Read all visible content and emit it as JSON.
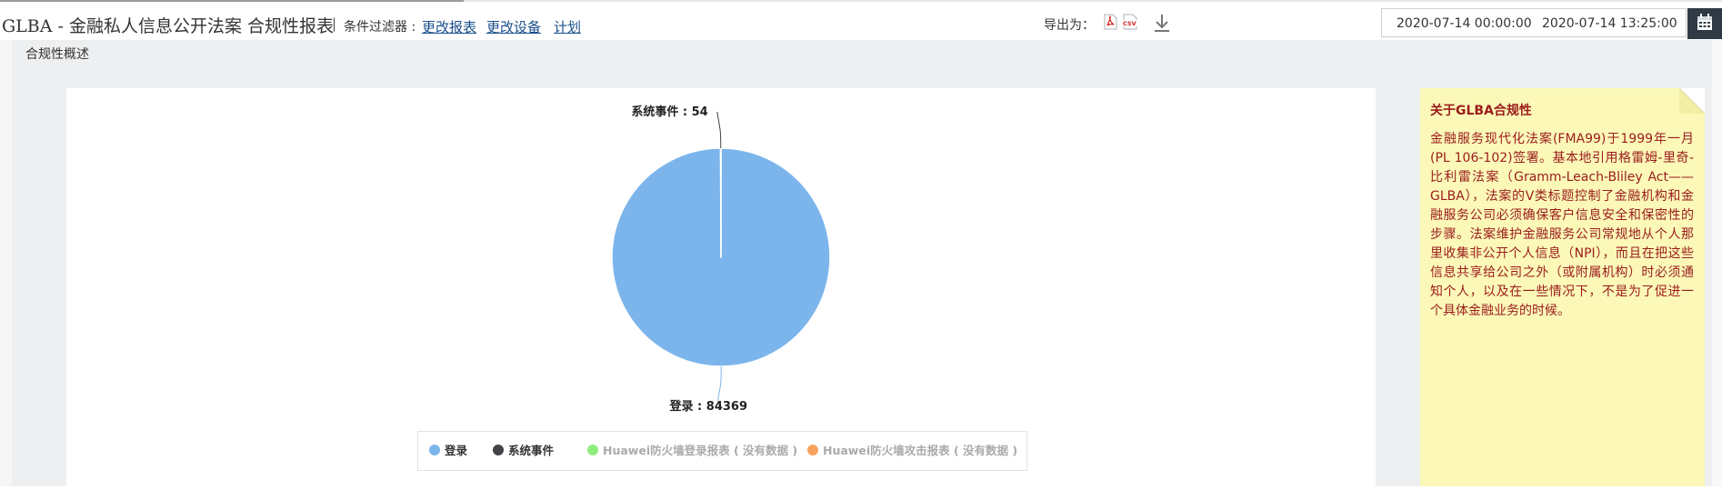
{
  "header": {
    "title": "GLBA - 金融私人信息公开法案 合规性报表",
    "separator": "|",
    "filter_label": "条件过滤器 : ",
    "links": [
      "更改报表",
      "更改设备",
      "计划"
    ],
    "export_label": "导出为：",
    "date_start": "2020-07-14 00:00:00",
    "date_end": "2020-07-14 13:25:00"
  },
  "section_title": "合规性概述",
  "chart_data": {
    "type": "pie",
    "slices": [
      {
        "name": "登录",
        "value": 84369,
        "color": "#7cb5ec",
        "label": "登录 : 84369"
      },
      {
        "name": "系统事件",
        "value": 54,
        "color": "#434348",
        "label": "系统事件 : 54"
      }
    ],
    "legend": [
      {
        "label": "登录",
        "color": "#7cb5ec",
        "has_data": true
      },
      {
        "label": "系统事件",
        "color": "#434348",
        "has_data": true
      },
      {
        "label": "Huawei防火墙登录报表 ( 没有数据 )",
        "color": "#90ed7d",
        "has_data": false
      },
      {
        "label": "Huawei防火墙攻击报表 ( 没有数据 )",
        "color": "#f7a35c",
        "has_data": false
      }
    ]
  },
  "note": {
    "title": "关于GLBA合规性",
    "body": "金融服务现代化法案(FMA99)于1999年一月(PL 106-102)签署。基本地引用格雷姆-里奇-比利雷法案（Gramm-Leach-Bliley Act——GLBA），法案的V类标题控制了金融机构和金融服务公司必须确保客户信息安全和保密性的步骤。法案维护金融服务公司常规地从个人那里收集非公开个人信息（NPI），而且在把这些信息共享给公司之外（或附属机构）时必须通知个人，以及在一些情况下，不是为了促进一个具体金融业务的时候。"
  }
}
